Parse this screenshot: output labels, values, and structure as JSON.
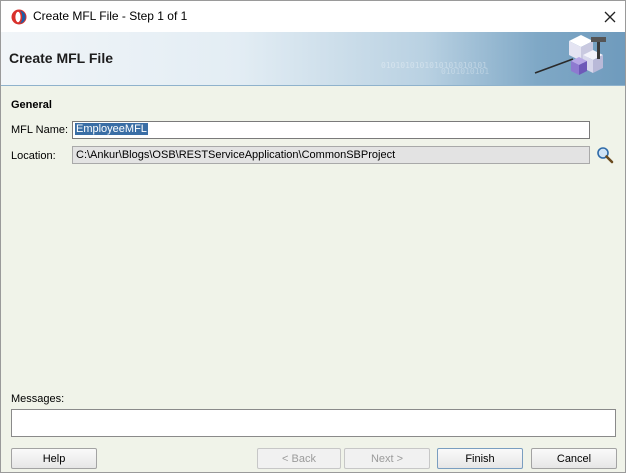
{
  "window": {
    "title": "Create MFL File - Step 1 of 1"
  },
  "banner": {
    "title": "Create MFL File"
  },
  "form": {
    "section_title": "General",
    "name_label": "MFL Name:",
    "name_value": "EmployeeMFL",
    "location_label": "Location:",
    "location_value": "C:\\Ankur\\Blogs\\OSB\\RESTServiceApplication\\CommonSBProject"
  },
  "messages": {
    "label": "Messages:"
  },
  "buttons": {
    "help": "Help",
    "back": "< Back",
    "next": "Next >",
    "finish": "Finish",
    "cancel": "Cancel"
  },
  "icons": {
    "app": "jdeveloper-app-icon",
    "close": "close-icon",
    "search": "magnifier-search-icon",
    "banner": "wizard-cubes-graphic"
  },
  "colors": {
    "banner_end": "#6f9bbd",
    "selection": "#3a6ea5",
    "panel_bg": "#f0f3e9"
  }
}
